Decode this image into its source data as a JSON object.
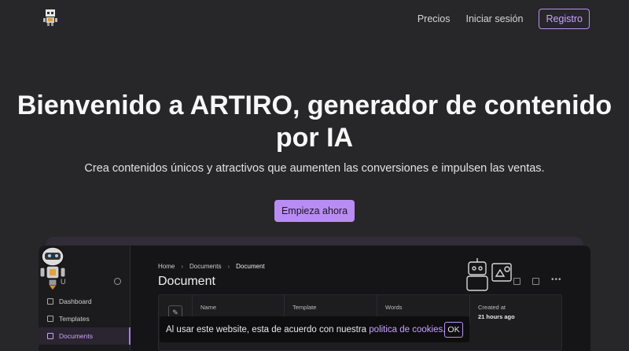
{
  "header": {
    "nav": {
      "pricing": "Precios",
      "login": "Iniciar sesión",
      "register": "Registro"
    }
  },
  "hero": {
    "title_line1": "Bienvenido a ARTIRO, generador de contenido",
    "title_line2": "por IA",
    "subtitle": "Crea contenidos únicos y atractivos que aumenten las conversiones e impulsen las ventas.",
    "cta": "Empieza ahora"
  },
  "preview": {
    "sidebar": {
      "user_initial": "U",
      "items": [
        {
          "label": "Dashboard",
          "icon": "grid-icon"
        },
        {
          "label": "Templates",
          "icon": "template-icon"
        },
        {
          "label": "Documents",
          "icon": "document-icon",
          "active": true
        }
      ]
    },
    "breadcrumb": [
      "Home",
      "Documents",
      "Document"
    ],
    "title": "Document",
    "meta": {
      "name_label": "Name",
      "template_label": "Template",
      "words_label": "Words",
      "created_label": "Created at",
      "created_value": "21 hours ago"
    }
  },
  "cookie": {
    "text": "Al usar este website, esta de acuerdo con nuestra ",
    "link": "politica de cookies",
    "end": ".",
    "ok": "OK"
  },
  "colors": {
    "background": "#272629",
    "accent": "#b98cf4"
  }
}
